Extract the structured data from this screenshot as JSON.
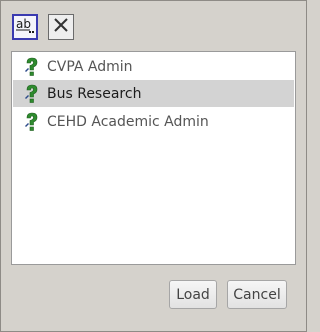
{
  "toolbar": {
    "buttons": [
      {
        "icon": "text-abbreviation-icon",
        "active": true
      },
      {
        "icon": "close-icon",
        "active": false
      }
    ]
  },
  "list": {
    "items": [
      {
        "label": "CVPA Admin",
        "icon": "green-question-mark-icon",
        "selected": false
      },
      {
        "label": "Bus Research",
        "icon": "green-question-mark-icon",
        "selected": true
      },
      {
        "label": "CEHD Academic Admin",
        "icon": "green-question-mark-icon",
        "selected": false
      }
    ]
  },
  "actions": {
    "load_label": "Load",
    "cancel_label": "Cancel"
  },
  "colors": {
    "icon_green": "#2e8b2e",
    "selection": "#d3d3d3",
    "panel_bg": "#d5d2cc"
  }
}
